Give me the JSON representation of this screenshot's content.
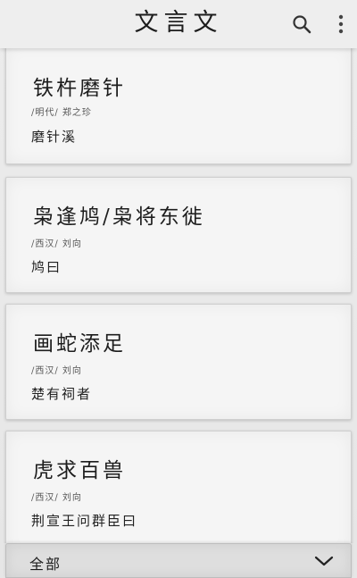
{
  "app": {
    "title": "文言文"
  },
  "toolbar": {
    "search_icon": "search-icon",
    "more_icon": "more-vert-icon"
  },
  "articles": [
    {
      "title": "铁杵磨针",
      "meta": "/明代/ 郑之珍",
      "excerpt": "磨针溪"
    },
    {
      "title": "枭逢鸠/枭将东徙",
      "meta": "/西汉/ 刘向",
      "excerpt": "鸠曰"
    },
    {
      "title": "画蛇添足",
      "meta": "/西汉/ 刘向",
      "excerpt": "楚有祠者"
    },
    {
      "title": "虎求百兽",
      "meta": "/西汉/ 刘向",
      "excerpt": "荆宣王问群臣曰"
    }
  ],
  "filter": {
    "selected": "全部",
    "icon": "chevron-down-icon"
  },
  "colors": {
    "background": "#e9e9e9",
    "card": "#f5f5f5",
    "text": "#222222"
  }
}
